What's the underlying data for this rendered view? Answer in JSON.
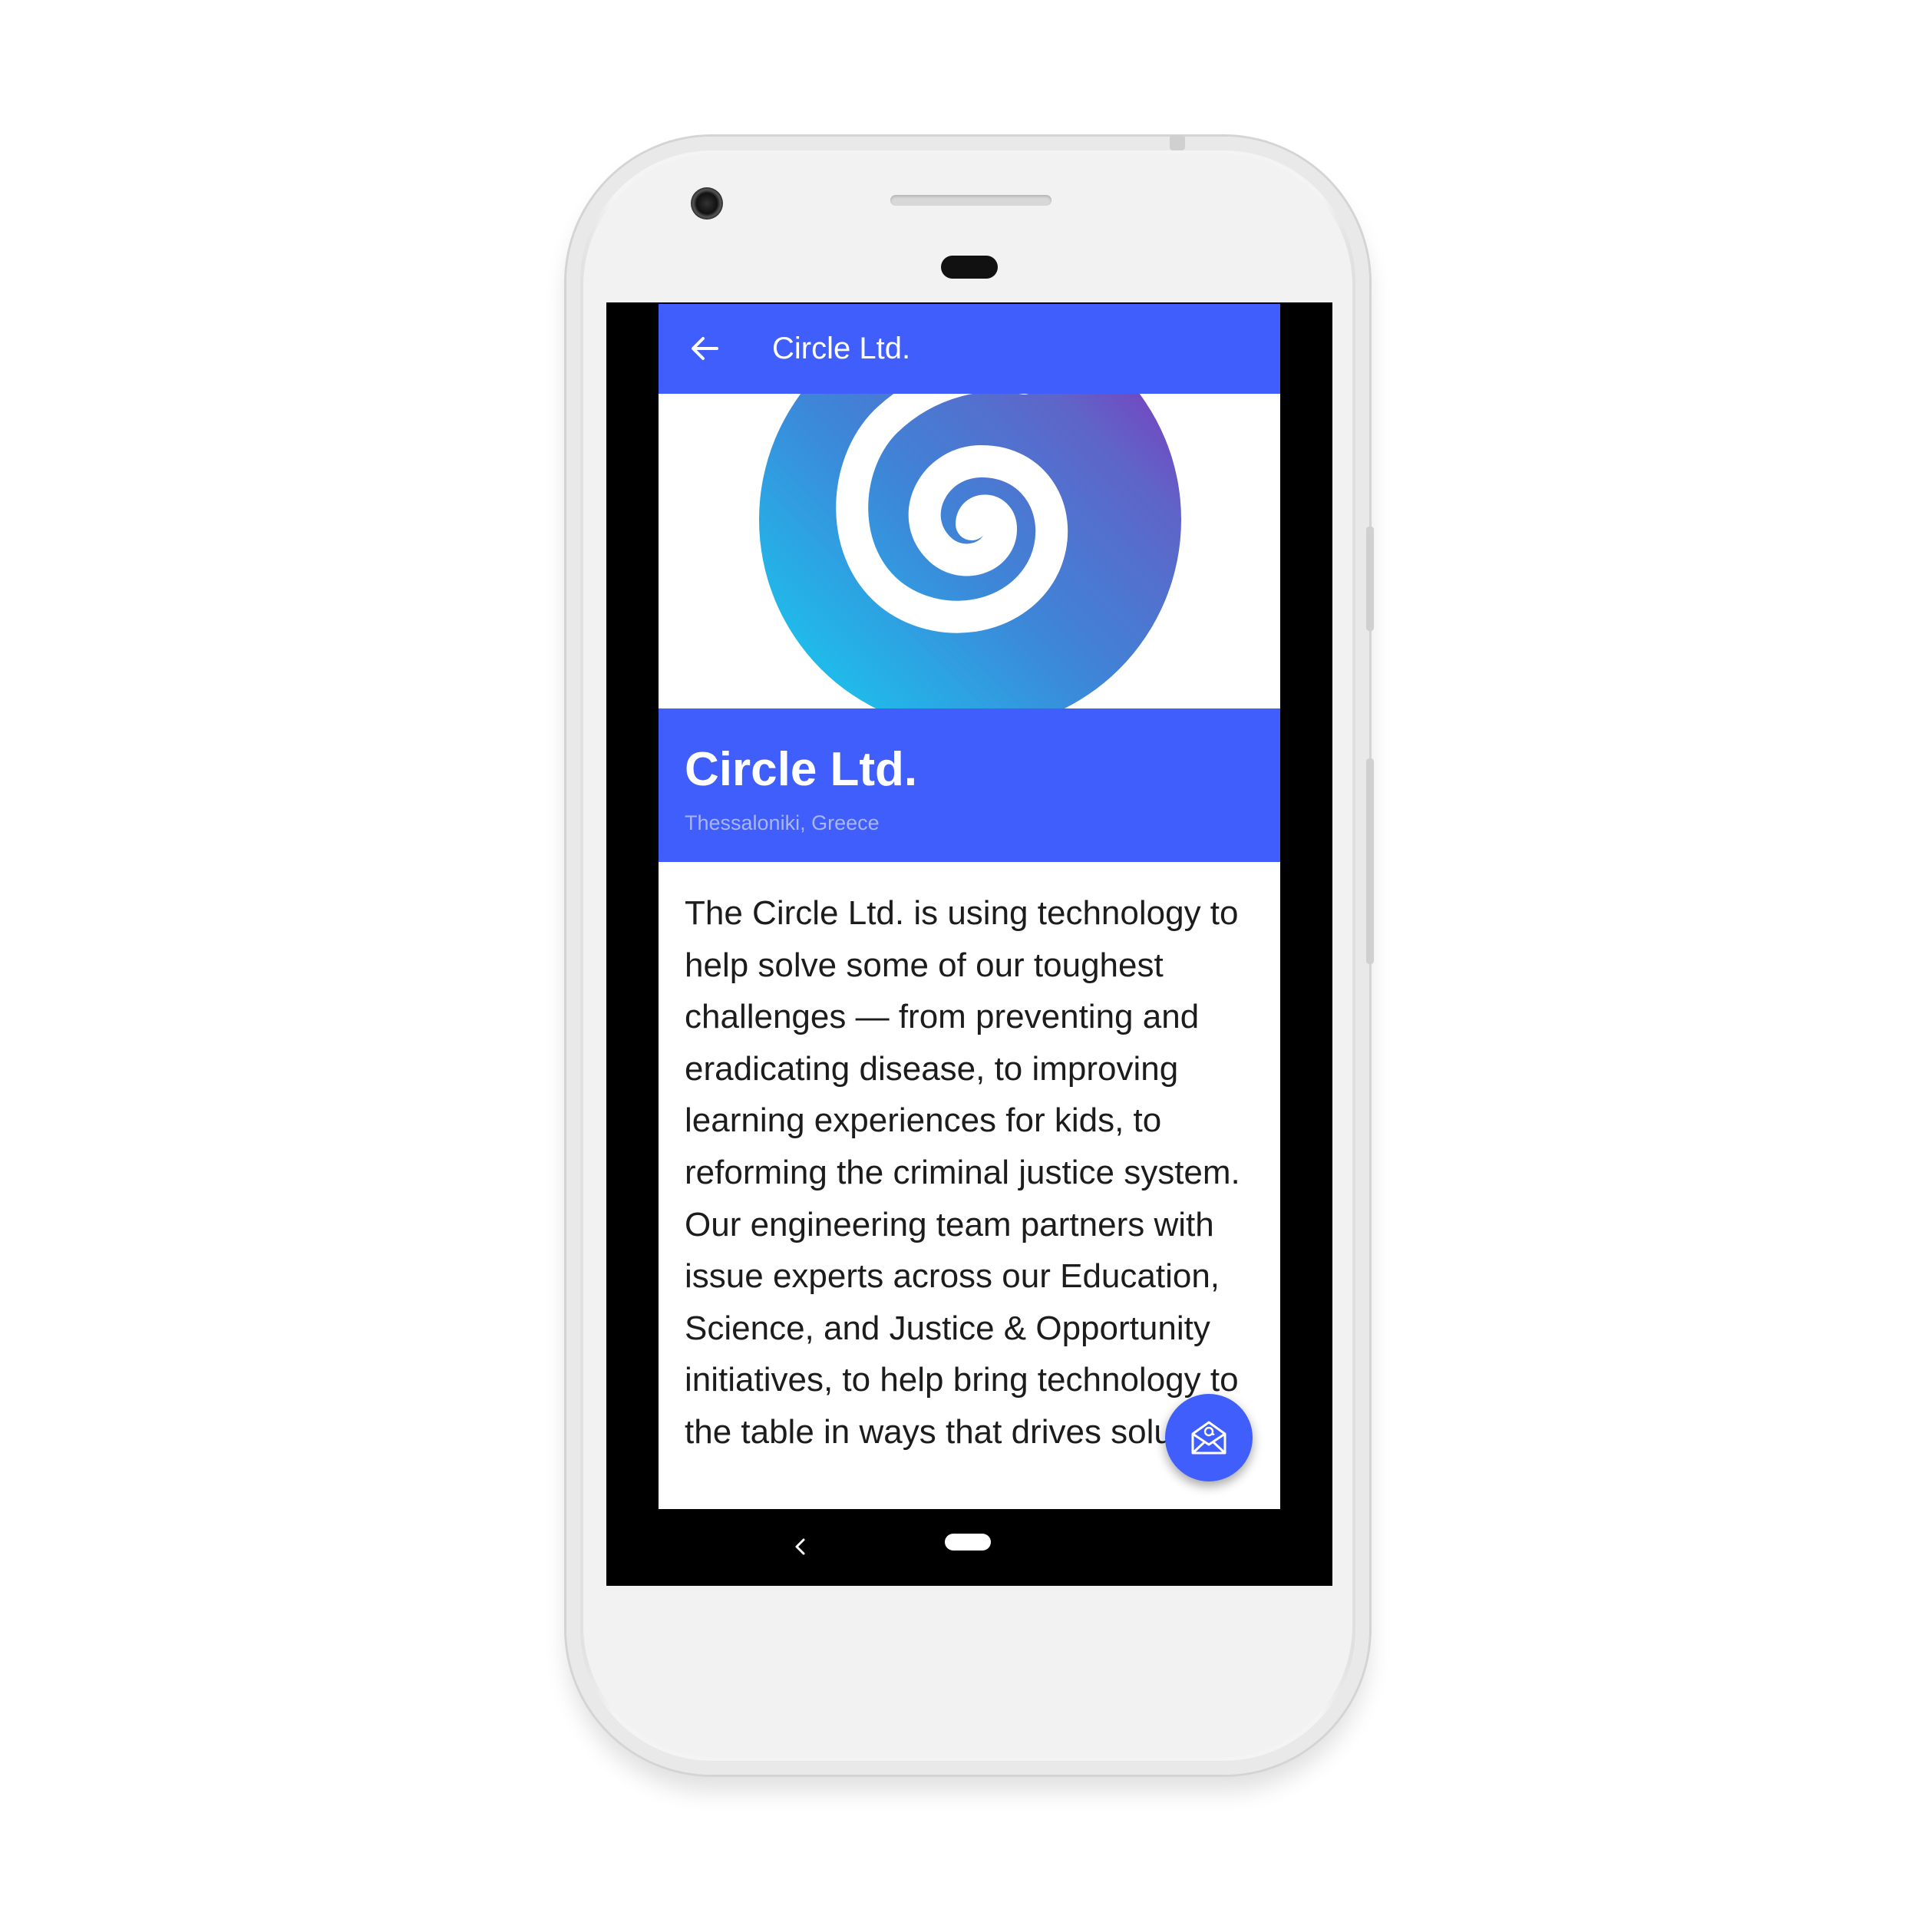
{
  "toolbar": {
    "title": "Circle Ltd.",
    "back_icon": "arrow-back-icon",
    "background_color": "#3f5efb"
  },
  "company": {
    "name": "Circle Ltd.",
    "location": "Thessaloniki, Greece",
    "logo_icon": "spiral-logo"
  },
  "description": "The Circle Ltd. is using technology to help solve some of our toughest challenges — from preventing and eradicating disease, to improving learning experiences for kids, to reforming the criminal justice system. Our engineering team partners with issue experts across our Education, Science, and Justice & Opportunity initiatives, to help bring technology to the table in ways that drives solutions.",
  "fab": {
    "icon": "email-open-icon",
    "color": "#3f5efb"
  },
  "navigation": {
    "back_icon": "nav-back-icon",
    "home_icon": "nav-home-pill"
  },
  "colors": {
    "accent": "#3f5efb",
    "location_text": "#a9b6ff",
    "logo_gradient_start": "#17c4ef",
    "logo_gradient_end": "#8a2ebc"
  }
}
